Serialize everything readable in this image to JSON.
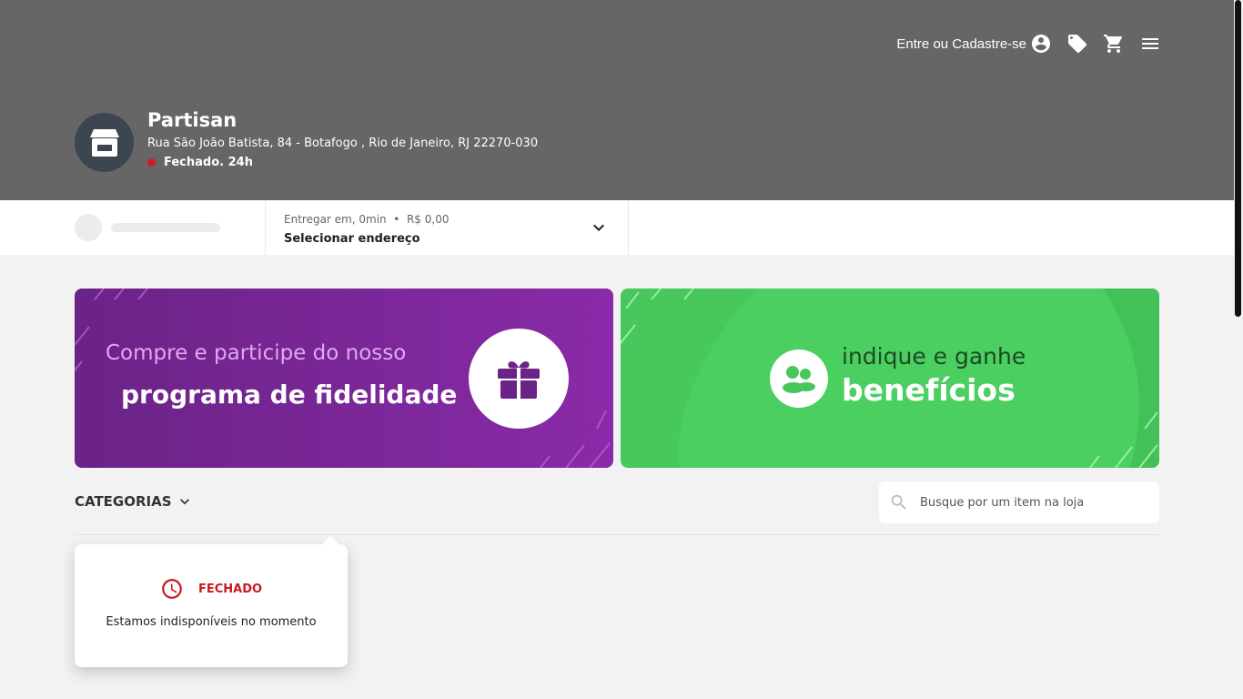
{
  "header": {
    "login_label": "Entre ou Cadastre-se",
    "icons": [
      "account-circle-icon",
      "tag-icon",
      "cart-icon",
      "menu-icon"
    ]
  },
  "store": {
    "name": "Partisan",
    "address": "Rua São João Batista, 84 - Botafogo , Rio de Janeiro, RJ 22270-030",
    "status": "Fechado. 24h",
    "status_color": "#d31a24"
  },
  "delivery": {
    "line1": "Entregar em, 0min  •  R$ 0,00",
    "line2": "Selecionar endereço"
  },
  "banners": {
    "loyalty": {
      "line1": "Compre e participe do nosso",
      "line2": "programa de fidelidade"
    },
    "referral": {
      "line1": "indique e ganhe",
      "line2": "benefícios"
    }
  },
  "categories": {
    "label": "CATEGORIAS"
  },
  "search": {
    "placeholder": "Busque por um item na loja"
  },
  "closed_card": {
    "title": "FECHADO",
    "message": "Estamos indisponíveis no momento"
  },
  "colors": {
    "header_bg": "#666666",
    "purple": "#8a2aa8",
    "green": "#47c75c",
    "closed_red": "#c8191f"
  }
}
